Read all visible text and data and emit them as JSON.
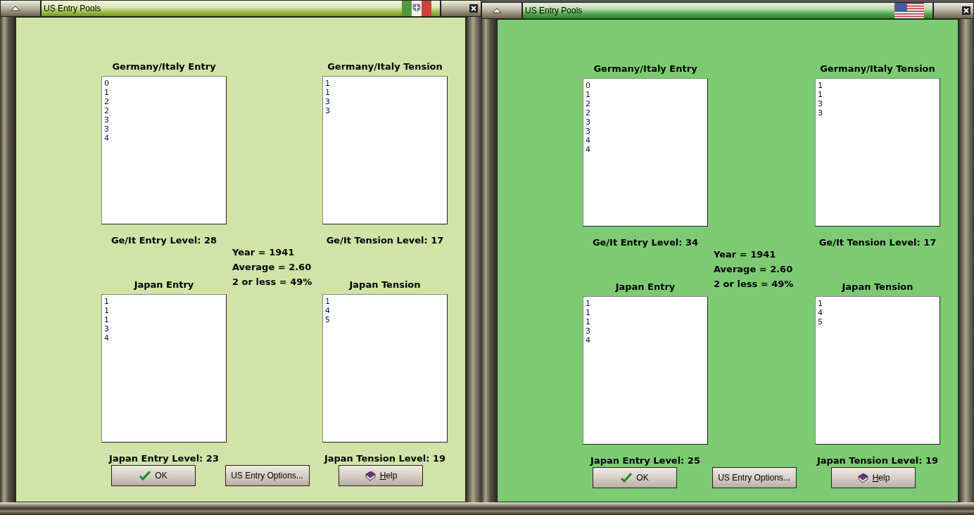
{
  "windows": [
    {
      "title": "US Entry Pools",
      "flag": {
        "kind": "italy"
      },
      "pools": [
        {
          "heading": "Germany/Italy Entry",
          "values": [
            "0",
            "1",
            "2",
            "2",
            "3",
            "3",
            "4"
          ],
          "level_label": "Ge/It Entry Level: 28"
        },
        {
          "heading": "Germany/Italy Tension",
          "values": [
            "1",
            "1",
            "3",
            "3"
          ],
          "level_label": "Ge/It Tension Level: 17"
        },
        {
          "heading": "Japan Entry",
          "values": [
            "1",
            "1",
            "1",
            "3",
            "4"
          ],
          "level_label": "Japan Entry Level: 23"
        },
        {
          "heading": "Japan Tension",
          "values": [
            "1",
            "4",
            "5"
          ],
          "level_label": "Japan Tension Level: 19"
        }
      ],
      "stats": [
        "Year = 1941",
        "Average = 2.60",
        "2 or less = 49%"
      ],
      "buttons": [
        {
          "label": "OK",
          "kind": "ok"
        },
        {
          "label": "US Entry Options...",
          "kind": "plain"
        },
        {
          "label": "Help",
          "kind": "help"
        }
      ]
    },
    {
      "title": "US Entry Pools",
      "flag": {
        "kind": "usa"
      },
      "pools": [
        {
          "heading": "Germany/Italy Entry",
          "values": [
            "0",
            "1",
            "2",
            "2",
            "3",
            "3",
            "4",
            "4"
          ],
          "level_label": "Ge/It Entry Level: 34"
        },
        {
          "heading": "Germany/Italy Tension",
          "values": [
            "1",
            "1",
            "3",
            "3"
          ],
          "level_label": "Ge/It Tension Level: 17"
        },
        {
          "heading": "Japan Entry",
          "values": [
            "1",
            "1",
            "1",
            "3",
            "4"
          ],
          "level_label": "Japan Entry Level: 25"
        },
        {
          "heading": "Japan Tension",
          "values": [
            "1",
            "4",
            "5"
          ],
          "level_label": "Japan Tension Level: 19"
        }
      ],
      "stats": [
        "Year = 1941",
        "Average = 2.60",
        "2 or less = 49%"
      ],
      "buttons": [
        {
          "label": "OK",
          "kind": "ok"
        },
        {
          "label": "US Entry Options...",
          "kind": "plain"
        },
        {
          "label": "Help",
          "kind": "help"
        }
      ]
    }
  ]
}
